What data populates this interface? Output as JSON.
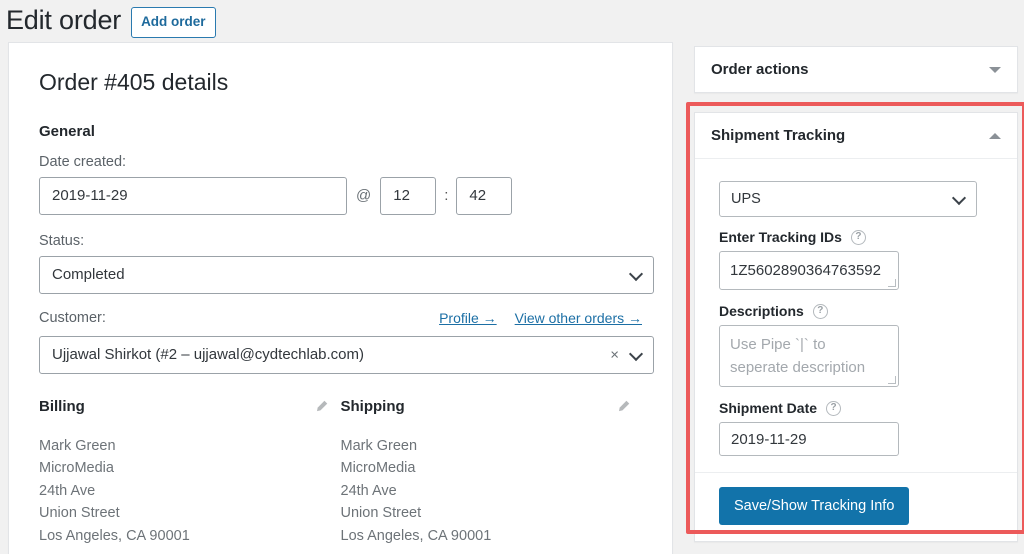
{
  "header": {
    "title": "Edit order",
    "add_order_label": "Add order"
  },
  "order_panel": {
    "title": "Order #405 details",
    "general_heading": "General",
    "date_created_label": "Date created:",
    "date_created_value": "2019-11-29",
    "at_symbol": "@",
    "hour_value": "12",
    "time_separator": ":",
    "minute_value": "42",
    "status_label": "Status:",
    "status_value": "Completed",
    "customer_label": "Customer:",
    "customer_value": "Ujjawal Shirkot (#2 – ujjawal@cydtechlab.com)",
    "clear_symbol": "×",
    "profile_link": "Profile →",
    "view_other_orders_link": "View other orders →",
    "billing": {
      "heading": "Billing",
      "lines": [
        "Mark Green",
        "MicroMedia",
        "24th Ave",
        "Union Street",
        "Los Angeles, CA 90001"
      ]
    },
    "shipping": {
      "heading": "Shipping",
      "lines": [
        "Mark Green",
        "MicroMedia",
        "24th Ave",
        "Union Street",
        "Los Angeles, CA 90001"
      ]
    }
  },
  "sidebar": {
    "order_actions": {
      "title": "Order actions",
      "state": "collapsed"
    },
    "shipment_tracking": {
      "title": "Shipment Tracking",
      "state": "expanded",
      "provider_value": "UPS",
      "tracking_ids_label": "Enter Tracking IDs",
      "tracking_ids_value": "1Z5602890364763592",
      "descriptions_label": "Descriptions",
      "descriptions_placeholder": "Use Pipe `|` to seperate description",
      "shipment_date_label": "Shipment Date",
      "shipment_date_value": "2019-11-29",
      "save_label": "Save/Show Tracking Info",
      "help_glyph": "?"
    }
  },
  "colors": {
    "accent_blue": "#1273aa",
    "link_blue": "#1c6fa5",
    "highlight_red": "#ec5a5a",
    "page_bg": "#f1f1f1",
    "panel_border": "#e2e4e7"
  }
}
